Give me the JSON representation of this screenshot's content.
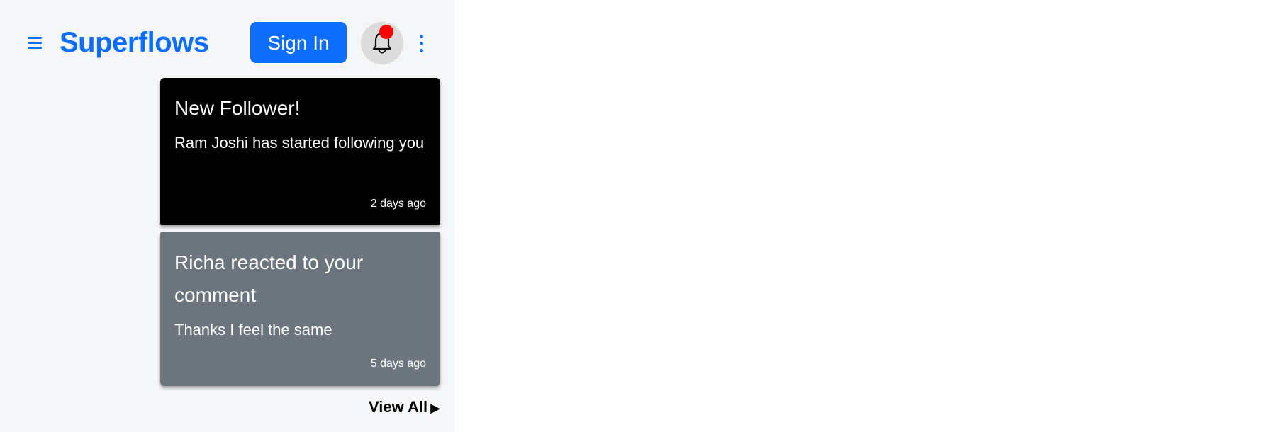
{
  "header": {
    "brand": "Superflows",
    "sign_in_label": "Sign In"
  },
  "notifications": {
    "items": [
      {
        "title": "New Follower!",
        "message": "Ram Joshi has started following you",
        "time": "2 days ago",
        "color": "#000000"
      },
      {
        "title": "Richa reacted to your comment",
        "message": "Thanks I feel the same",
        "time": "5 days ago",
        "color": "#6c757d"
      }
    ],
    "view_all_label": "View All",
    "view_all_arrow": "▶"
  },
  "colors": {
    "brand": "#0d6efd",
    "badge": "#ff0000",
    "bell_background": "#dcdcdc",
    "page_background": "#f5f6f8"
  },
  "icons": {
    "menu": "hamburger-icon",
    "bell": "bell-icon",
    "more": "kebab-menu-icon"
  }
}
